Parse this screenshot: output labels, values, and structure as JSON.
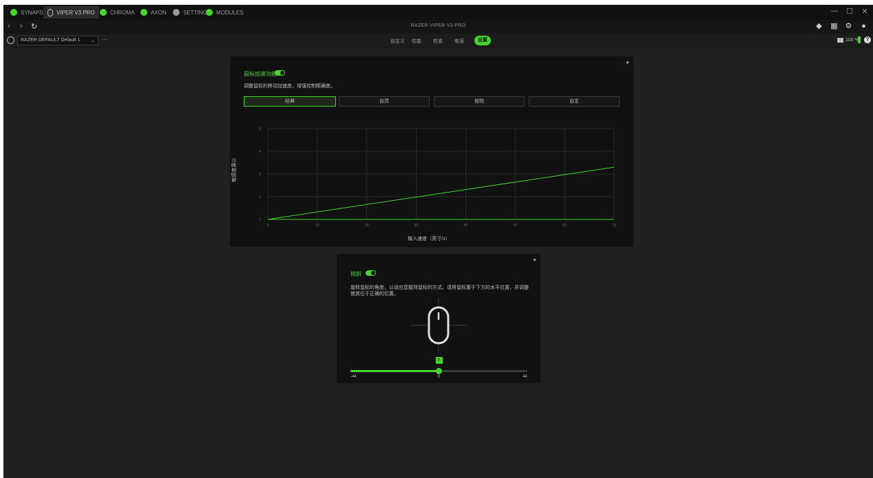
{
  "tabs": [
    {
      "label": "SYNAPSE",
      "icon": "razer-logo-icon"
    },
    {
      "label": "VIPER V3 PRO",
      "icon": "mouse-icon"
    },
    {
      "label": "CHROMA",
      "icon": "chroma-icon"
    },
    {
      "label": "AXON",
      "icon": "axon-icon"
    },
    {
      "label": "SETTINGS",
      "icon": "gear-icon"
    },
    {
      "label": "MODULES",
      "icon": "modules-icon"
    }
  ],
  "window_controls": {
    "minimize": "—",
    "maximize": "☐",
    "close": "✕"
  },
  "nav": {
    "back": "‹",
    "forward": "›",
    "refresh": "↻"
  },
  "window_title": "RAZER VIPER V3 PRO",
  "profile": {
    "selected": "RAZER DEFAULT Default 1",
    "more": "···"
  },
  "subtabs": [
    "自定义",
    "性能",
    "校准",
    "电源"
  ],
  "subtab_active": "设置",
  "battery": {
    "percent": "100 %",
    "level": 1.0
  },
  "accel_panel": {
    "title": "鼠标加速功能",
    "enabled": true,
    "description": "调整鼠标的移动加速度，增强控制精确度。",
    "segments": [
      "经典",
      "自然",
      "抛物",
      "自定"
    ],
    "active_segment": 0
  },
  "chart_data": {
    "type": "line",
    "xlabel": "输入速度（英寸/s）",
    "ylabel": "敏感度乘以",
    "x_ticks": [
      "0",
      "10",
      "20",
      "30",
      "40",
      "50",
      "60",
      "70"
    ],
    "y_ticks": [
      "1",
      "2",
      "3",
      "4",
      "5"
    ],
    "xlim": [
      0,
      70
    ],
    "ylim": [
      1,
      5
    ],
    "series": [
      {
        "x": [
          0,
          70
        ],
        "y": [
          1,
          3.3
        ]
      }
    ],
    "grid": true,
    "colors": {
      "line": "#44d62c",
      "grid": "#2e3a2c"
    }
  },
  "tilt_panel": {
    "title": "倾斜",
    "enabled": true,
    "description": "旋转鼠标的角度，以适应您握持鼠标的方式。请将鼠标置于下方的水平位置，并调整使其位于正确的位置。",
    "slider": {
      "min": "-44",
      "max": "44",
      "value": "0",
      "min_val": -44,
      "max_val": 44,
      "current": 0
    }
  },
  "colors": {
    "accent": "#44d62c",
    "bg": "#202020",
    "panel": "#111111"
  }
}
